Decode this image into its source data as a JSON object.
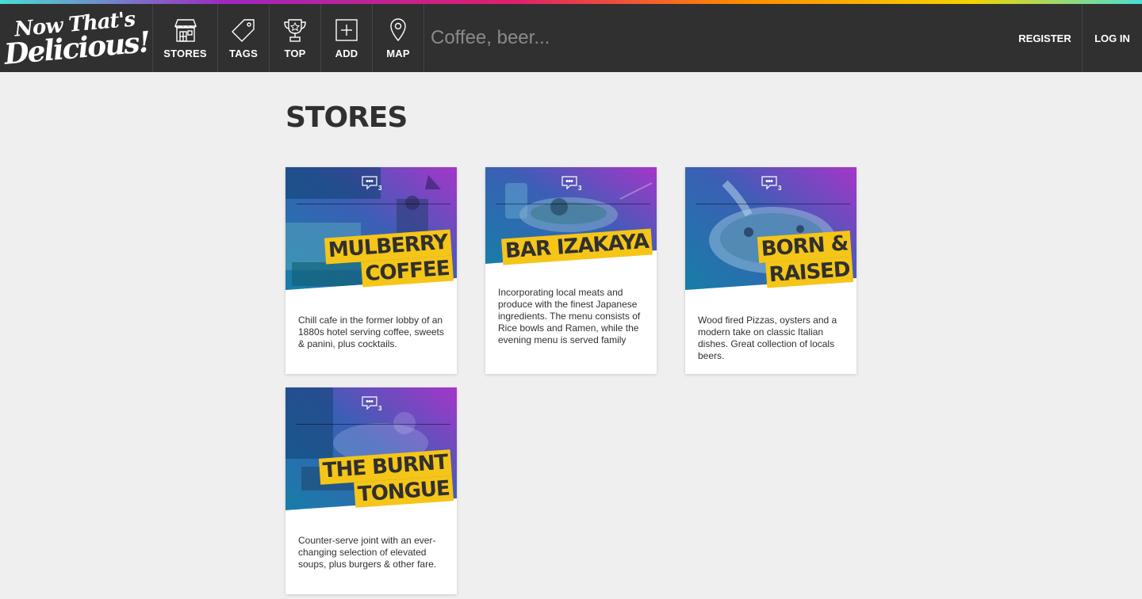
{
  "colors": {
    "nav_bg": "#303030",
    "page_bg": "#efefef",
    "highlight": "#f5c518",
    "accent_blue": "#1a6fb0",
    "accent_purple": "#9b2fc9"
  },
  "logo": {
    "line1": "Now That's",
    "line2": "Delicious!"
  },
  "nav": [
    {
      "label": "STORES",
      "icon": "store-icon"
    },
    {
      "label": "TAGS",
      "icon": "tag-icon"
    },
    {
      "label": "TOP",
      "icon": "trophy-icon"
    },
    {
      "label": "ADD",
      "icon": "add-icon"
    },
    {
      "label": "MAP",
      "icon": "map-pin-icon"
    }
  ],
  "search": {
    "placeholder": "Coffee, beer..."
  },
  "auth": {
    "register": "REGISTER",
    "login": "LOG IN"
  },
  "page": {
    "title": "STORES"
  },
  "stores": [
    {
      "name_line1": "MULBERRY",
      "name_line2": "COFFEE",
      "comments": "3",
      "description": "Chill cafe in the former lobby of an 1880s hotel serving coffee, sweets & panini, plus cocktails."
    },
    {
      "name_line1": "BAR IZAKAYA",
      "name_line2": "",
      "comments": "3",
      "description": "Incorporating local meats and produce with the finest Japanese ingredients. The menu consists of Rice bowls and Ramen, while the evening menu is served family"
    },
    {
      "name_line1": "BORN &",
      "name_line2": "RAISED",
      "comments": "3",
      "description": "Wood fired Pizzas, oysters and a modern take on classic Italian dishes. Great collection of locals beers."
    },
    {
      "name_line1": "THE BURNT",
      "name_line2": "TONGUE",
      "comments": "3",
      "description": "Counter-serve joint with an ever-changing selection of elevated soups, plus burgers & other fare."
    }
  ]
}
